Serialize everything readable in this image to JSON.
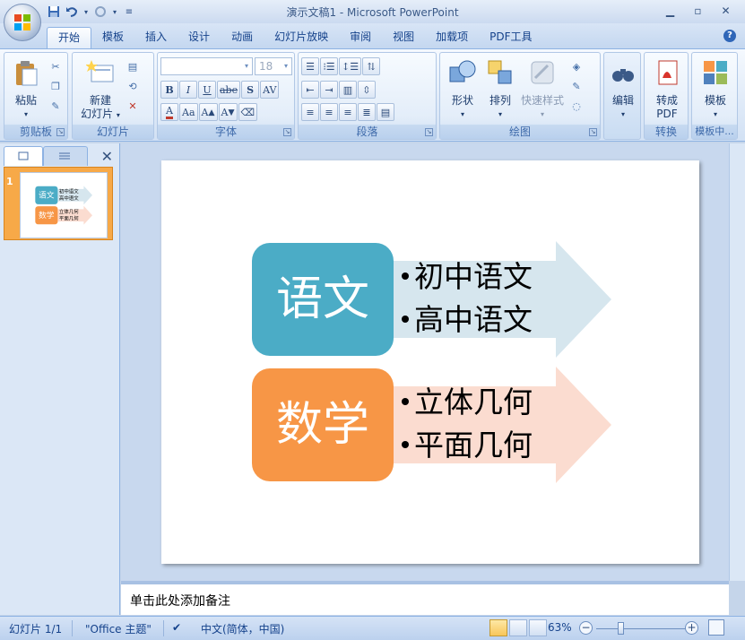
{
  "window": {
    "title": "演示文稿1 - Microsoft PowerPoint",
    "minimize_icon": "minimize-icon",
    "maximize_icon": "restore-icon",
    "close_icon": "close-icon"
  },
  "quick_access": [
    "save-icon",
    "undo-icon",
    "redo-icon",
    "customize-icon"
  ],
  "tabs": [
    {
      "label": "开始",
      "active": true
    },
    {
      "label": "模板"
    },
    {
      "label": "插入"
    },
    {
      "label": "设计"
    },
    {
      "label": "动画"
    },
    {
      "label": "幻灯片放映"
    },
    {
      "label": "审阅"
    },
    {
      "label": "视图"
    },
    {
      "label": "加载项"
    },
    {
      "label": "PDF工具"
    }
  ],
  "ribbon": {
    "clipboard": {
      "label": "剪贴板",
      "paste": "粘贴"
    },
    "slides": {
      "label": "幻灯片",
      "new_slide_line1": "新建",
      "new_slide_line2": "幻灯片"
    },
    "font": {
      "label": "字体",
      "font_name": "",
      "font_size": "18"
    },
    "paragraph": {
      "label": "段落"
    },
    "drawing": {
      "label": "绘图",
      "shapes": "形状",
      "arrange": "排列",
      "quick_styles": "快速样式"
    },
    "editing": {
      "label": "编辑"
    },
    "convert": {
      "label": "转换",
      "line1": "转成",
      "line2": "PDF"
    },
    "templates": {
      "label": "模板中...",
      "button": "模板"
    }
  },
  "slide": {
    "rows": [
      {
        "title": "语文",
        "color": "#4bacc6",
        "arrow_color": "#d6e6ee",
        "items": [
          "初中语文",
          "高中语文"
        ]
      },
      {
        "title": "数学",
        "color": "#f79646",
        "arrow_color": "#fbdcd0",
        "items": [
          "立体几何",
          "平面几何"
        ]
      }
    ]
  },
  "thumbnail": {
    "number": "1"
  },
  "notes": {
    "placeholder": "单击此处添加备注"
  },
  "status": {
    "slide_count": "幻灯片 1/1",
    "theme": "\"Office 主题\"",
    "language": "中文(简体，中国)",
    "zoom": "63%"
  }
}
